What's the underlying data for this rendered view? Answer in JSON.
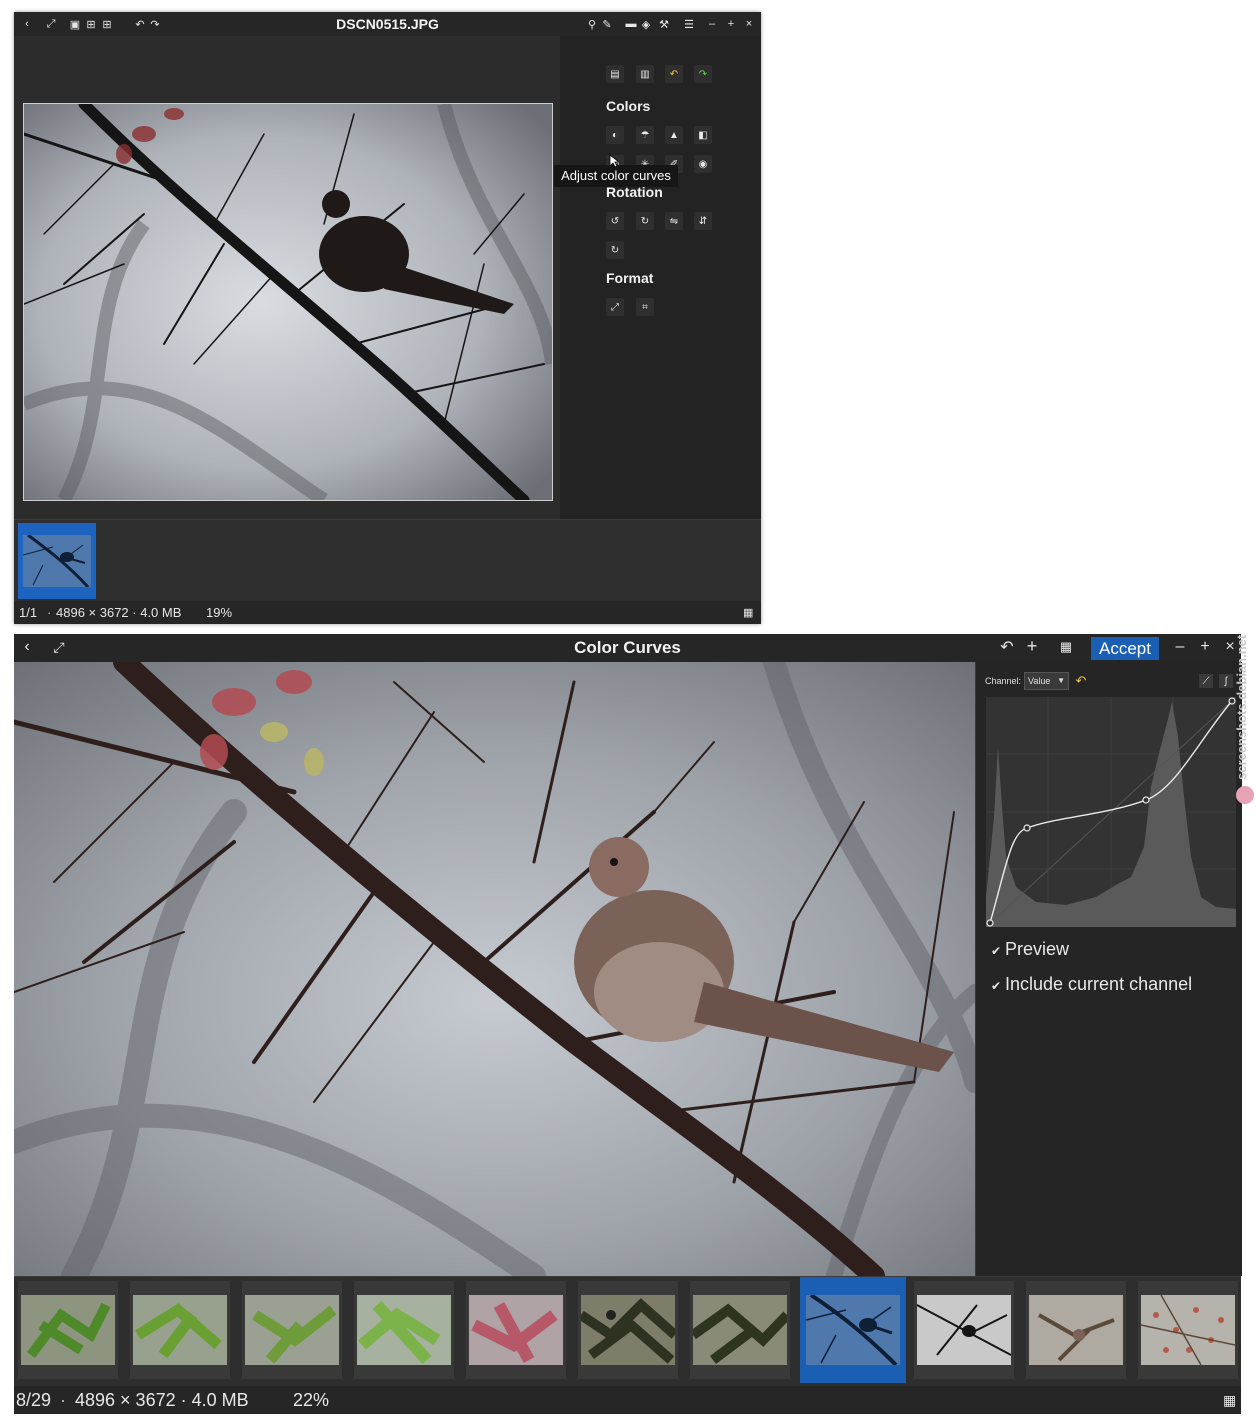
{
  "window1": {
    "title": "DSCN0515.JPG",
    "tooltip": "Adjust color curves",
    "sections": {
      "colors": "Colors",
      "rotation": "Rotation",
      "format": "Format"
    },
    "status": {
      "index": "1/1",
      "info": "4896 × 3672 · 4.0 MB",
      "zoom": "19%"
    }
  },
  "window2": {
    "title": "Color Curves",
    "accept_label": "Accept",
    "channel_label": "Channel:",
    "channel_value": "Value",
    "preview_label": "Preview",
    "include_label": "Include current channel",
    "status": {
      "index": "8/29",
      "info": "4896 × 3672 · 4.0 MB",
      "zoom": "22%"
    },
    "selected_thumbnail": 8,
    "thumbnail_count_visible": 11
  },
  "watermark": "screenshots.debian.net",
  "colors": {
    "accent": "#1b5fb4",
    "panel": "#252526",
    "titlebar": "#262627"
  }
}
